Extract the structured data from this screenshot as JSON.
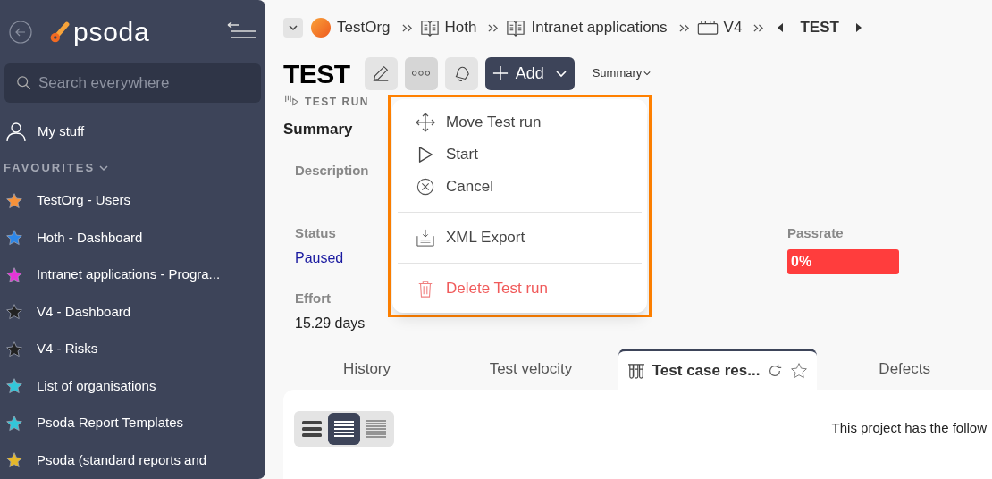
{
  "sidebar": {
    "logo": "psoda",
    "search": {
      "placeholder": "Search everywhere"
    },
    "my_stuff": "My stuff",
    "favourites_heading": "FAVOURITES",
    "favourites": [
      {
        "label": "TestOrg - Users",
        "color": "#f7923a"
      },
      {
        "label": "Hoth - Dashboard",
        "color": "#2d87e8"
      },
      {
        "label": "Intranet applications - Progra...",
        "color": "#e535d6"
      },
      {
        "label": "V4 - Dashboard",
        "color": "#222222"
      },
      {
        "label": "V4 - Risks",
        "color": "#222222"
      },
      {
        "label": "List of organisations",
        "color": "#33c6d9"
      },
      {
        "label": "Psoda Report Templates",
        "color": "#33c6d9"
      },
      {
        "label": "Psoda (standard reports and",
        "color": "#e6b82a"
      }
    ]
  },
  "breadcrumb": [
    {
      "kind": "org",
      "label": "TestOrg"
    },
    {
      "kind": "book",
      "label": "Hoth"
    },
    {
      "kind": "book",
      "label": "Intranet applications"
    },
    {
      "kind": "board",
      "label": "V4"
    },
    {
      "kind": "current",
      "label": "TEST"
    }
  ],
  "title": "TEST",
  "add_button": "Add",
  "summary_menu": "Summary",
  "type_label": "TEST RUN",
  "summary": {
    "heading": "Summary",
    "fields": [
      {
        "label": "Description"
      },
      {
        "label": "Status",
        "value": "Paused",
        "kind": "link"
      },
      {
        "label": "Effort",
        "value": "15.29 days"
      }
    ],
    "passrate": {
      "label": "Passrate",
      "value": "0%"
    }
  },
  "menu": {
    "items": [
      {
        "kind": "move",
        "label": "Move Test run"
      },
      {
        "kind": "start",
        "label": "Start"
      },
      {
        "kind": "cancel",
        "label": "Cancel"
      },
      {
        "kind": "divider"
      },
      {
        "kind": "xml",
        "label": "XML Export"
      },
      {
        "kind": "divider"
      },
      {
        "kind": "delete",
        "label": "Delete Test run"
      }
    ]
  },
  "tabs": [
    {
      "label": "History",
      "selected": false
    },
    {
      "label": "Test velocity",
      "selected": false
    },
    {
      "label": "Test case res...",
      "selected": true
    },
    {
      "label": "Defects",
      "selected": false
    }
  ],
  "view_modes": [
    {
      "kind": "large",
      "selected": false
    },
    {
      "kind": "medium",
      "selected": true
    },
    {
      "kind": "small",
      "selected": false
    }
  ],
  "panel_text": "This project has the follow"
}
